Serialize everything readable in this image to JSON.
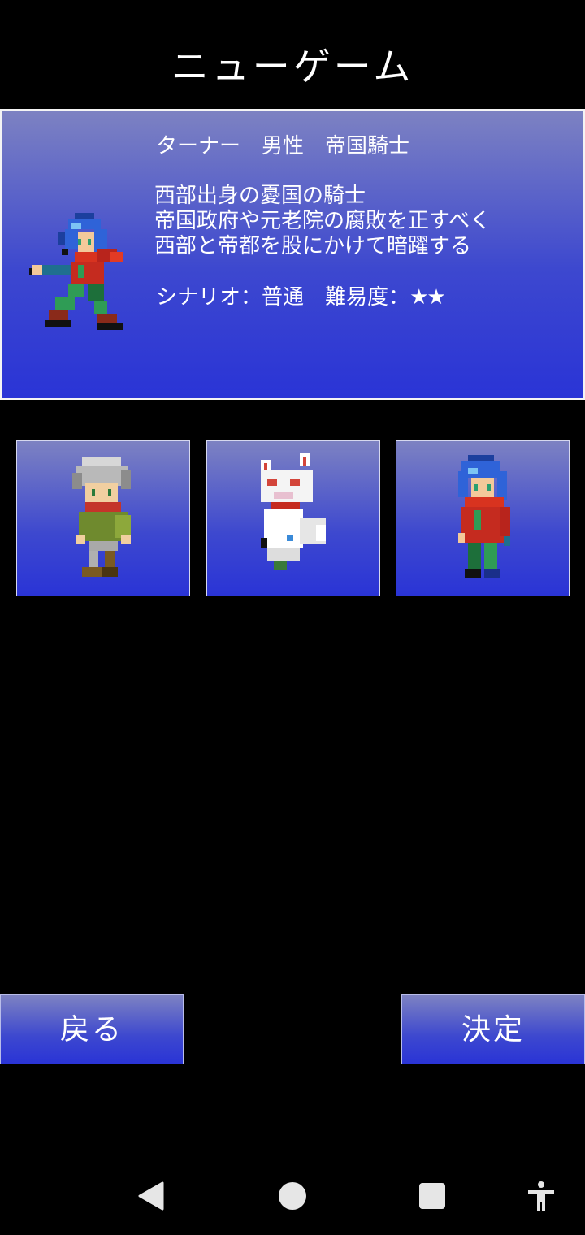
{
  "screen": {
    "title": "ニューゲーム"
  },
  "selected_character": {
    "header": "ターナー　男性　帝国騎士",
    "description_lines": [
      "西部出身の憂国の騎士",
      "帝国政府や元老院の腐敗を正すべく",
      "西部と帝都を股にかけて暗躍する"
    ],
    "scenario_label": "シナリオ：",
    "scenario_value": "普通",
    "difficulty_label": "難易度：",
    "difficulty_stars": "★★"
  },
  "character_slots": [
    {
      "sprite": "silver-haired-boy-sprite"
    },
    {
      "sprite": "white-fox-creature-sprite"
    },
    {
      "sprite": "blue-haired-knight-sprite"
    }
  ],
  "buttons": {
    "back_label": "戻る",
    "confirm_label": "決定"
  },
  "system_nav": {
    "back_icon": "triangle-back-icon",
    "home_icon": "circle-home-icon",
    "recents_icon": "square-recents-icon",
    "accessibility_icon": "accessibility-person-icon"
  },
  "colors": {
    "panel_top": "#7d82c2",
    "panel_bottom": "#2a34d6",
    "background": "#000000"
  }
}
